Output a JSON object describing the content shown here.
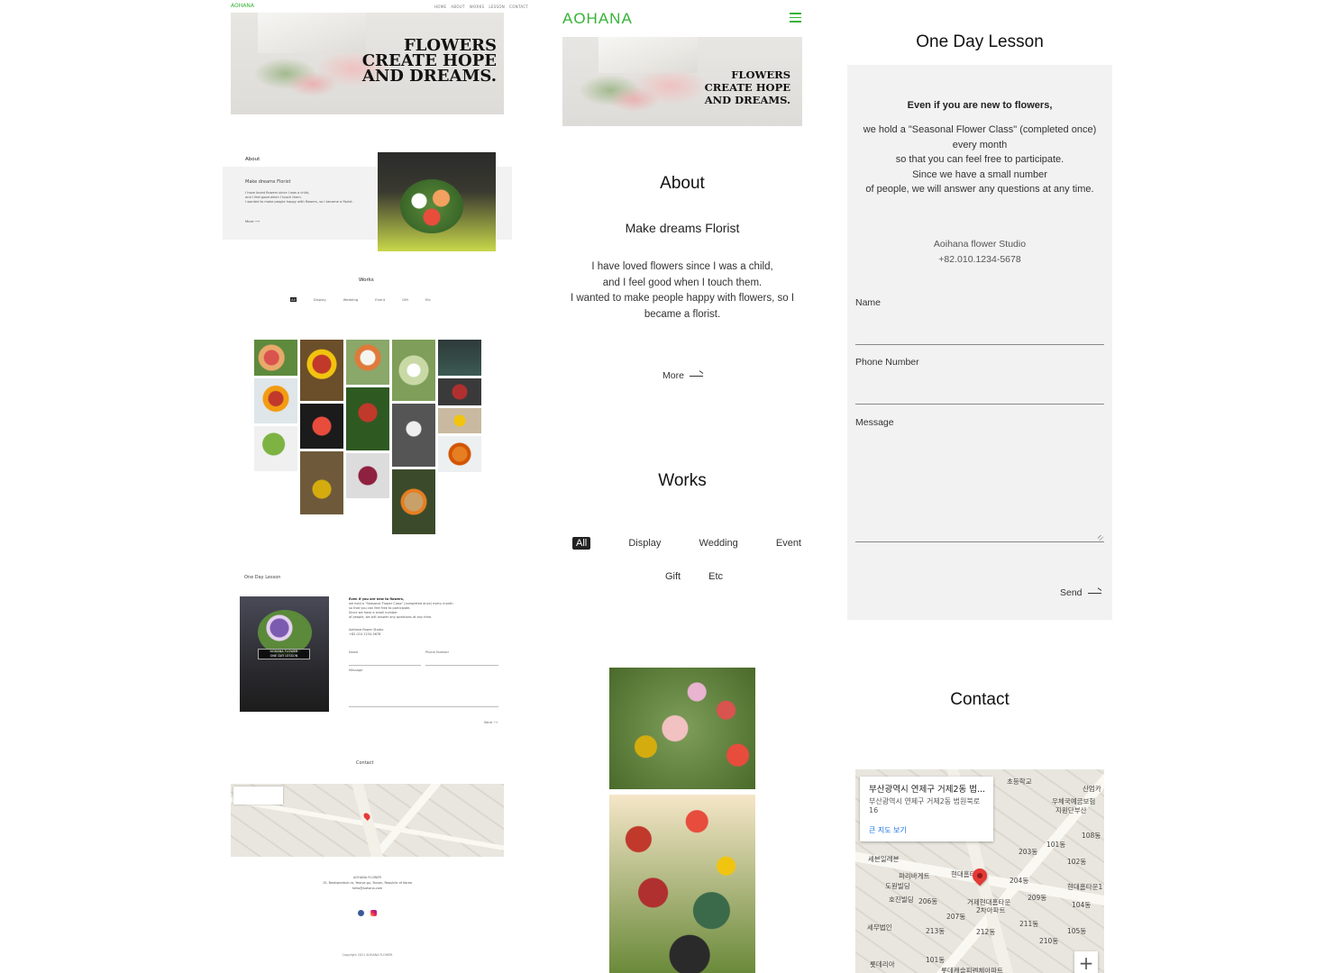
{
  "desktop": {
    "logo": "AOHANA",
    "nav": [
      "HOME",
      "ABOUT",
      "WORKS",
      "LESSON",
      "CONTACT"
    ],
    "hero": [
      "FLOWERS",
      "CREATE HOPE",
      "AND DREAMS."
    ],
    "about_title": "About",
    "about_subtitle": "Make dreams Florist",
    "about_lines": [
      "I have loved flowers since I was a child,",
      "and I feel good when I touch them.",
      "I wanted to make people happy with flowers, so I became a florist."
    ],
    "more": "More",
    "works_title": "Works",
    "tabs": [
      "All",
      "Display",
      "Wedding",
      "Event",
      "Gift",
      "Etc"
    ],
    "lesson_title": "One Day Lesson",
    "lesson_badge": [
      "AOHANA FLOWER",
      "ONE DAY LESSON"
    ],
    "lesson_lines": [
      "Even if you are new to flowers,",
      "we hold a \"Seasonal Flower Class\" (completed once) every month",
      "so that you can feel free to participate.",
      "Since we have a small number",
      "of people, we will answer any questions at any time."
    ],
    "studio": [
      "Aoihana flower Studio",
      "+82.010.1234-5678"
    ],
    "form": {
      "name": "Name",
      "phone": "Phone Number",
      "message": "Message",
      "send": "Send"
    },
    "contact_title": "Contact",
    "footer_lines": [
      "AOHANA FLOWER",
      "15, Beobwonbuk-ro, Yeonje-gu, Busan, Republic of Korea",
      "hello@aohana.com"
    ],
    "copyright": "Copyright 2021 AOHANA FLOWER"
  },
  "mobile": {
    "logo": "AOHANA",
    "hero": [
      "FLOWERS",
      "CREATE HOPE",
      "AND DREAMS."
    ],
    "about_title": "About",
    "about_subtitle": "Make dreams Florist",
    "about_lines": [
      "I have loved flowers since I was a child,",
      "and I feel good when I touch them.",
      "I wanted to make people happy with flowers, so I",
      "became a florist."
    ],
    "more": "More",
    "works_title": "Works",
    "tabs": [
      "All",
      "Display",
      "Wedding",
      "Event",
      "Gift",
      "Etc"
    ]
  },
  "lesson": {
    "title": "One Day Lesson",
    "lead": "Even if you are new to flowers,",
    "lines": [
      "we hold a \"Seasonal Flower Class\" (completed once)",
      "every month",
      "so that you can feel free to participate.",
      "Since we have a small number",
      "of people, we will answer any questions at any time."
    ],
    "studio": "Aoihana flower Studio",
    "phone": "+82.010.1234-5678",
    "name_label": "Name",
    "phone_label": "Phone Number",
    "message_label": "Message",
    "send": "Send"
  },
  "contact": {
    "title": "Contact",
    "map_card_title": "부산광역시 연제구 거제2동 법...",
    "map_card_address": "부산광역시 연제구 거제2동 법원북로 16",
    "map_card_link": "큰 지도 보기",
    "map_labels": [
      "초등학교",
      "우체국예금보험",
      "지원단부산",
      "세븐일레븐",
      "파리바게트",
      "현대홈타운",
      "도원빌딩",
      "호진빌딩",
      "206동",
      "207동",
      "거제현대홈타운",
      "2차아파트",
      "204동",
      "209동",
      "203동",
      "101동",
      "102동",
      "108동",
      "104동",
      "105동",
      "210동",
      "211동",
      "212동",
      "213동",
      "101동",
      "세무법인",
      "롯데리아",
      "롯데캐슬피렌체아파트",
      "현대홈타운1",
      "산엄카"
    ],
    "zoom_in": "+"
  },
  "colors": {
    "brand_green": "#35b335",
    "card_bg": "#f2f2f2",
    "text": "#222222"
  }
}
